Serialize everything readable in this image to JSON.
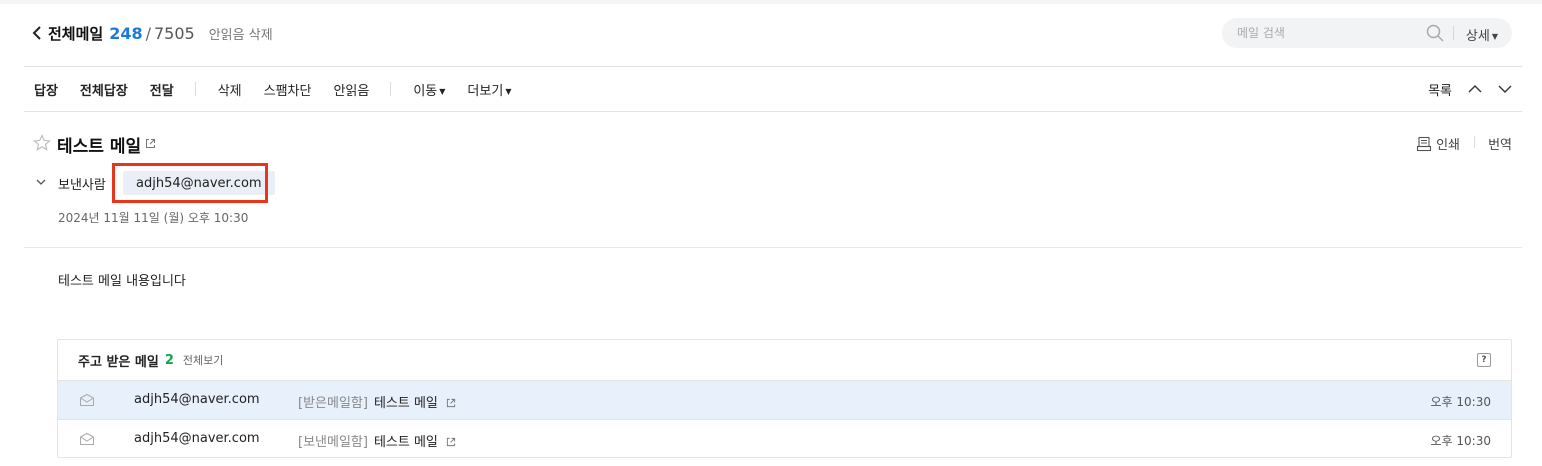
{
  "header": {
    "folder_title": "전체메일",
    "unread_count": "248",
    "slash": "/",
    "total_count": "7505",
    "mark_read_label": "안읽음 삭제",
    "search_placeholder": "메일 검색",
    "detail_label": "상세"
  },
  "toolbar": {
    "reply": "답장",
    "reply_all": "전체답장",
    "forward": "전달",
    "delete": "삭제",
    "block_spam": "스팸차단",
    "mark_unread": "안읽음",
    "move": "이동",
    "more": "더보기",
    "list": "목록"
  },
  "message": {
    "subject": "테스트 메일",
    "print_label": "인쇄",
    "translate_label": "번역",
    "sender_label": "보낸사람",
    "sender_email": "adjh54@naver.com",
    "date": "2024년 11월 11일 (월) 오후 10:30",
    "body": "테스트 메일 내용입니다"
  },
  "thread": {
    "title": "주고 받은 메일",
    "count": "2",
    "view_all": "전체보기",
    "help": "?",
    "rows": [
      {
        "from": "adjh54@naver.com",
        "folder": "[받은메일함]",
        "subject": "테스트 메일",
        "time": "오후 10:30"
      },
      {
        "from": "adjh54@naver.com",
        "folder": "[보낸메일함]",
        "subject": "테스트 메일",
        "time": "오후 10:30"
      }
    ]
  },
  "colors": {
    "accent_blue": "#1b7ad8",
    "count_green": "#16a34a",
    "highlight_red": "#e8361c",
    "selected_row": "#e8f0fb",
    "chip_bg": "#e9eef7"
  },
  "icons": [
    "back-icon",
    "search-icon",
    "chevron-up-icon",
    "chevron-down-icon",
    "star-icon",
    "popout-icon",
    "print-icon",
    "envelope-icon",
    "help-icon"
  ]
}
